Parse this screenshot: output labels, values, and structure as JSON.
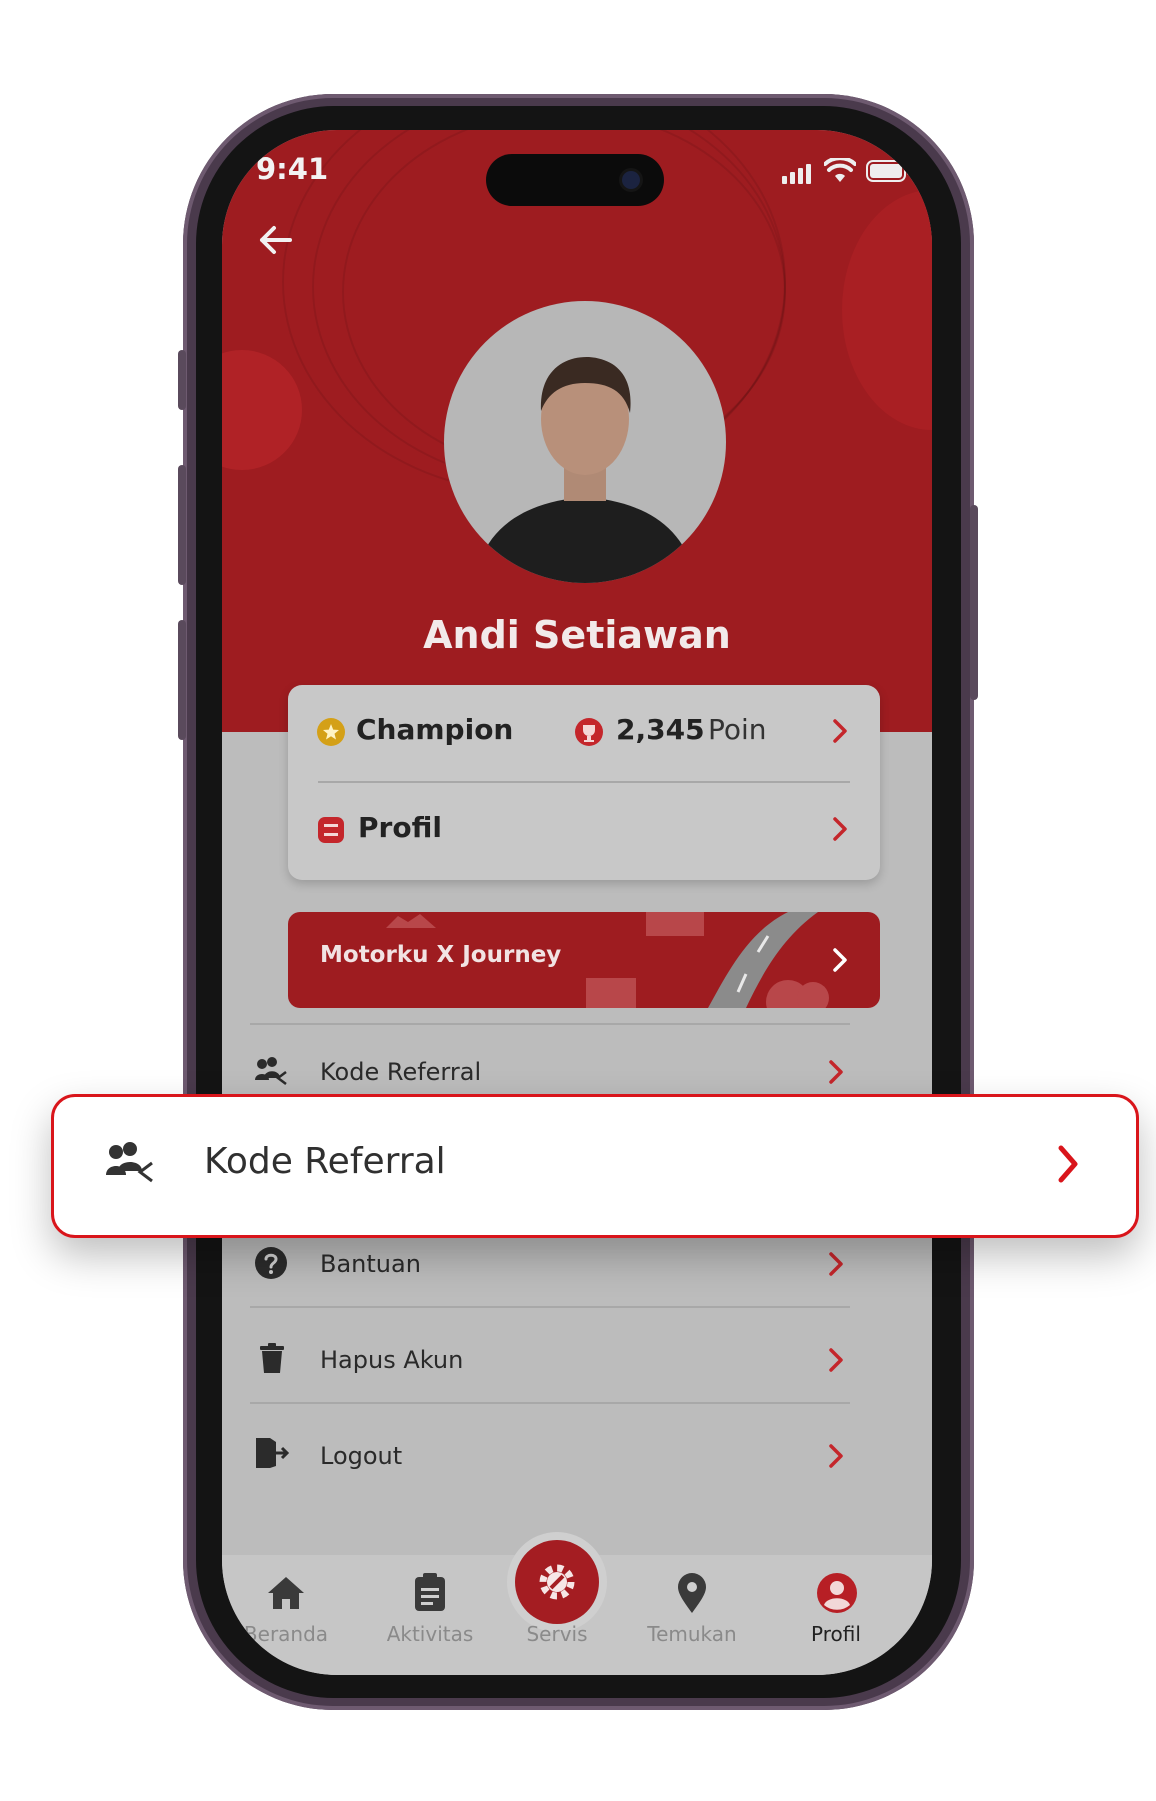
{
  "status_bar": {
    "time": "9:41"
  },
  "profile": {
    "name": "Andi Setiawan"
  },
  "summary_card": {
    "tier": "Champion",
    "points_value": "2,345",
    "points_unit": "Poin",
    "profile_label": "Profil"
  },
  "journey_banner": {
    "title": "Motorku X Journey"
  },
  "menu": {
    "items": [
      {
        "label": "Kode Referral"
      },
      {
        "label": "Bantuan"
      },
      {
        "label": "Hapus Akun"
      },
      {
        "label": "Logout"
      }
    ]
  },
  "highlight": {
    "label": "Kode Referral"
  },
  "bottom_nav": {
    "items": [
      {
        "label": "Beranda"
      },
      {
        "label": "Aktivitas"
      },
      {
        "label": "Servis"
      },
      {
        "label": "Temukan"
      },
      {
        "label": "Profil"
      }
    ]
  },
  "colors": {
    "brand_red": "#9e1c20",
    "highlight_border": "#d9151b",
    "gold": "#d4a017"
  }
}
